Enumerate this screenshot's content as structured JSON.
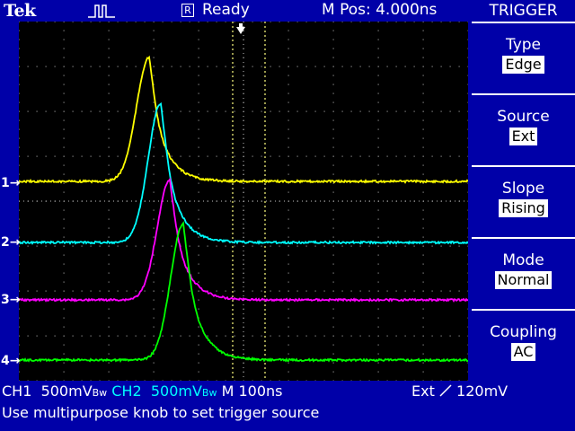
{
  "header": {
    "brand": "Tek",
    "run_status": "Ready",
    "run_icon_letter": "R",
    "mpos": "M Pos: 4.000ns"
  },
  "side_menu": {
    "title": "TRIGGER",
    "items": [
      {
        "label": "Type",
        "value": "Edge"
      },
      {
        "label": "Source",
        "value": "Ext"
      },
      {
        "label": "Slope",
        "value": "Rising"
      },
      {
        "label": "Mode",
        "value": "Normal"
      },
      {
        "label": "Coupling",
        "value": "AC"
      }
    ]
  },
  "channels": [
    {
      "id": "1",
      "color": "#ffff00"
    },
    {
      "id": "2",
      "color": "#00ffff"
    },
    {
      "id": "3",
      "color": "#ff00ff"
    },
    {
      "id": "4",
      "color": "#00ff00"
    }
  ],
  "status_bar": {
    "ch1_label": "CH1",
    "ch1_scale": "500mV",
    "bw1": "Bw",
    "ch2_label": "CH2",
    "ch2_scale": "500mV",
    "bw2": "Bw",
    "timebase": "M 100ns",
    "trigger_source": "Ext",
    "trigger_level": "120mV"
  },
  "message": "Use multipurpose knob to set trigger source",
  "icons": {
    "acquisition": "pulse-icon",
    "trigger_position": "down-arrow-icon",
    "trigger_slope": "rising-slope-icon"
  }
}
